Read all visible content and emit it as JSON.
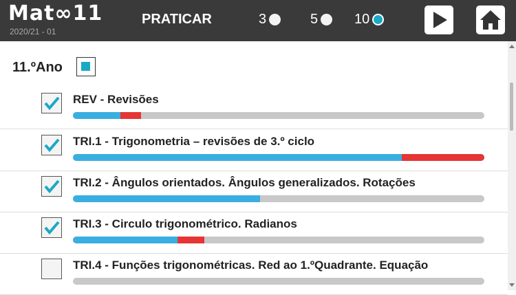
{
  "header": {
    "logo_prefix": "Mat",
    "logo_symbol": "∞",
    "logo_suffix": "11",
    "version": "2020/21 - 01",
    "mode_label": "PRATICAR",
    "options": [
      {
        "label": "3",
        "selected": false
      },
      {
        "label": "5",
        "selected": false
      },
      {
        "label": "10",
        "selected": true
      }
    ]
  },
  "year": {
    "label": "11.ºAno",
    "checked": "partial"
  },
  "colors": {
    "accent": "#1aa9c4",
    "progress_blue": "#3aaee0",
    "progress_red": "#e53535",
    "track": "#c8c8c8",
    "topbar": "#3a3a3a"
  },
  "items": [
    {
      "title": "REV  - Revisões",
      "checked": true,
      "blue": 0.115,
      "red": 0.05
    },
    {
      "title": "TRI.1 - Trigonometria – revisões de 3.º ciclo",
      "checked": true,
      "blue": 0.8,
      "red": 0.2
    },
    {
      "title": "TRI.2 - Ângulos orientados. Ângulos generalizados. Rotações",
      "checked": true,
      "blue": 0.455,
      "red": 0
    },
    {
      "title": "TRI.3 - Circulo trigonométrico. Radianos",
      "checked": true,
      "blue": 0.255,
      "red": 0.065
    },
    {
      "title": "TRI.4 - Funções trigonométricas. Red ao 1.ºQuadrante. Equação",
      "checked": false,
      "blue": 0,
      "red": 0
    }
  ]
}
